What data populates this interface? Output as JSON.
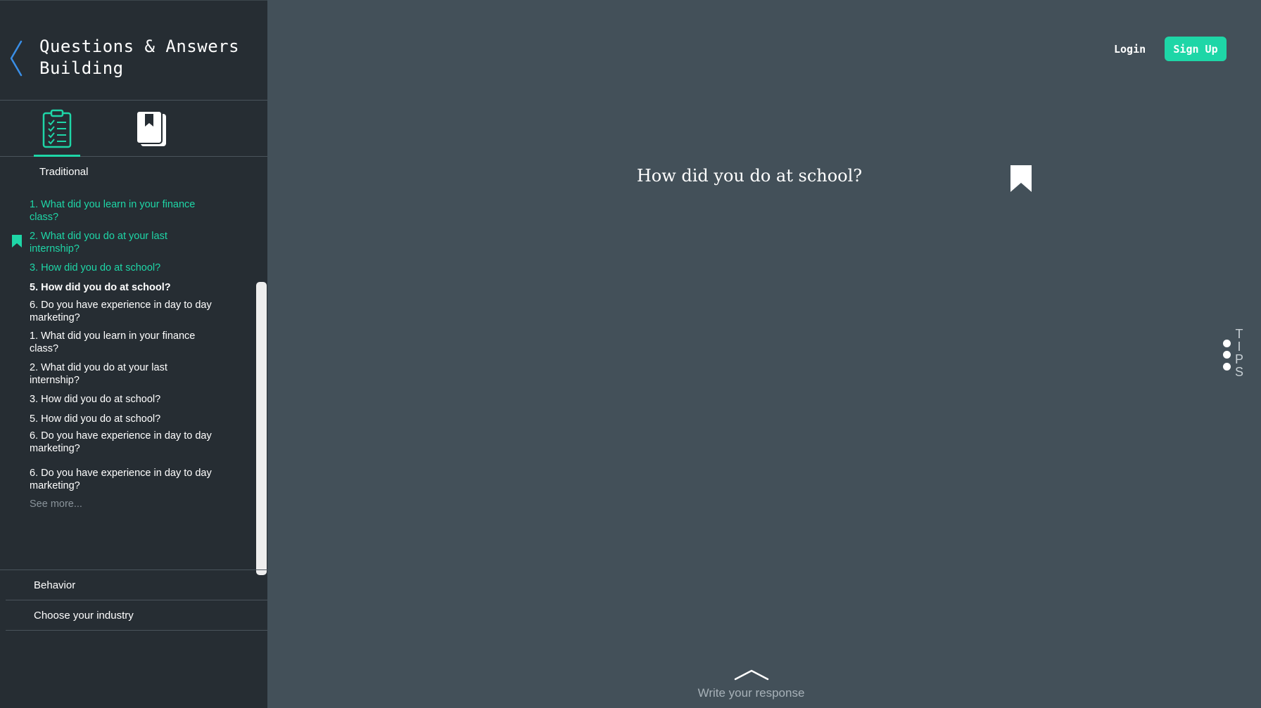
{
  "sidebar": {
    "title": "Questions & Answers Building",
    "tabs": [
      {
        "name": "questions",
        "icon": "clipboard-checklist-icon",
        "active": true
      },
      {
        "name": "library",
        "icon": "book-icon",
        "active": false
      }
    ],
    "section_title": "Traditional",
    "questions": [
      {
        "text": "1. What did you learn in your finance class?",
        "state": "answered"
      },
      {
        "text": "2. What did you do at your last internship?",
        "state": "answered",
        "bookmarked": true
      },
      {
        "text": "3. How did you do at school?",
        "state": "answered"
      },
      {
        "text": "5. How did you do at school?",
        "state": "current"
      },
      {
        "text": "6. Do you have experience in day to day marketing?",
        "state": "unanswered"
      },
      {
        "text": "1. What did you learn in your finance class?",
        "state": "unanswered"
      },
      {
        "text": "2. What did you do at your last internship?",
        "state": "unanswered"
      },
      {
        "text": "3. How did you do at school?",
        "state": "unanswered"
      },
      {
        "text": "5. How did you do at school?",
        "state": "unanswered"
      },
      {
        "text": "6. Do you have experience in day to day marketing?",
        "state": "unanswered"
      },
      {
        "text": "6. Do you have experience in day to day marketing?",
        "state": "unanswered"
      }
    ],
    "see_more": "See more...",
    "categories": [
      "Behavior",
      "Choose your industry"
    ]
  },
  "header": {
    "login": "Login",
    "signup": "Sign Up"
  },
  "main": {
    "question": "How did you do at school?",
    "tips_letters": [
      "T",
      "I",
      "P",
      "S"
    ],
    "write_response": "Write your response"
  },
  "colors": {
    "accent": "#1ed6a7",
    "sidebar_bg": "#262d33",
    "main_bg": "#435059",
    "back_chevron": "#3a8ee6"
  }
}
